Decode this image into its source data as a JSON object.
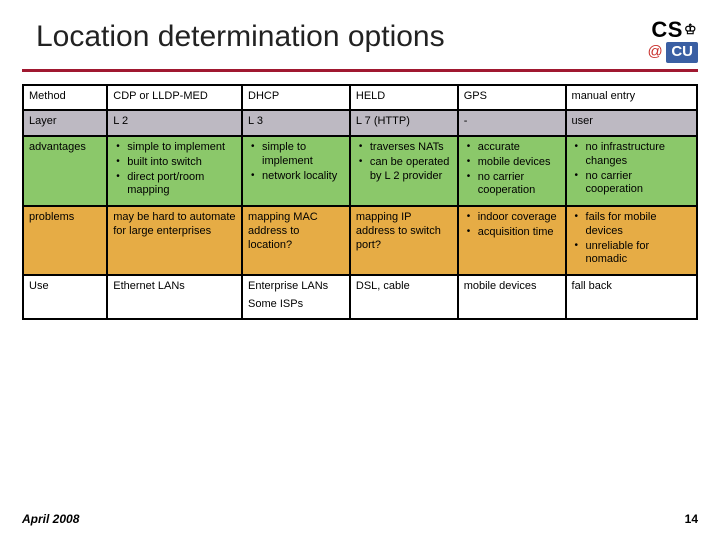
{
  "title": "Location determination options",
  "logo": {
    "cs": "CS",
    "at": "@",
    "cu": "CU"
  },
  "footer": {
    "date": "April 2008",
    "page": "14"
  },
  "table": {
    "rows": [
      {
        "label": "Method",
        "cells": [
          "CDP or LLDP-MED",
          "DHCP",
          "HELD",
          "GPS",
          "manual entry"
        ]
      },
      {
        "label": "Layer",
        "cells": [
          "L 2",
          "L 3",
          "L 7 (HTTP)",
          "-",
          "user"
        ]
      },
      {
        "label": "advantages",
        "bullets": [
          [
            "simple to implement",
            "built into switch",
            "direct port/room mapping"
          ],
          [
            "simple to implement",
            "network locality"
          ],
          [
            "traverses NATs",
            "can be operated by L 2 provider"
          ],
          [
            "accurate",
            "mobile devices",
            "no carrier cooperation"
          ],
          [
            "no infrastructure changes",
            "no carrier cooperation"
          ]
        ]
      },
      {
        "label": "problems",
        "mixed": [
          {
            "text": "may be hard to automate for large enterprises"
          },
          {
            "text": "mapping MAC address to location?"
          },
          {
            "text": "mapping IP address to switch port?"
          },
          {
            "bullets": [
              "indoor coverage",
              "acquisition time"
            ]
          },
          {
            "bullets": [
              "fails for mobile devices",
              "unreliable for nomadic"
            ]
          }
        ]
      },
      {
        "label": "Use",
        "mixed": [
          {
            "text": "Ethernet LANs"
          },
          {
            "lines": [
              "Enterprise LANs",
              "Some ISPs"
            ]
          },
          {
            "text": "DSL, cable"
          },
          {
            "text": "mobile devices"
          },
          {
            "text": "fall back"
          }
        ]
      }
    ]
  }
}
